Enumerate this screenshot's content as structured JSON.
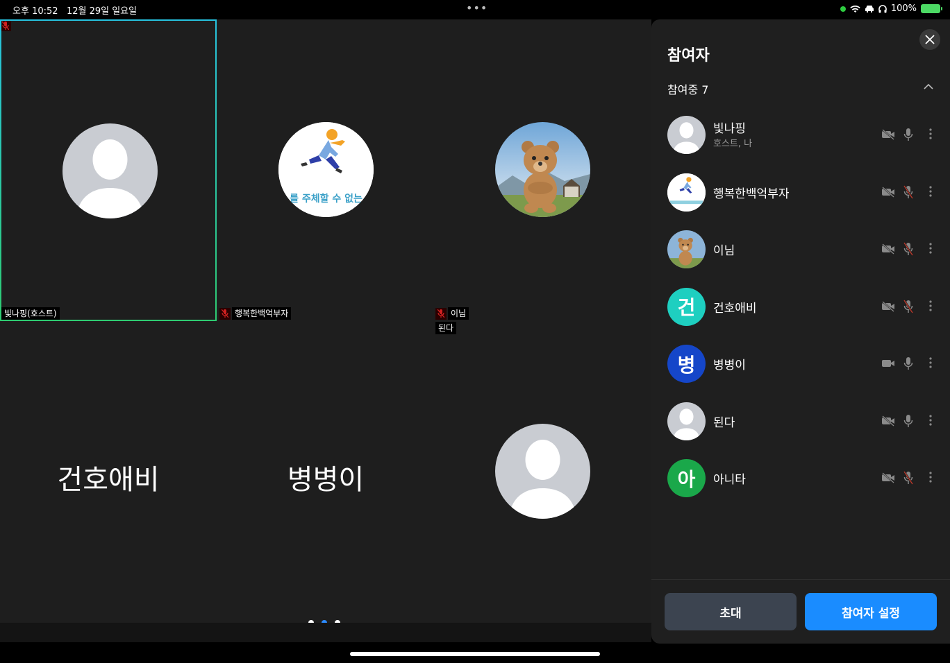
{
  "status_bar": {
    "time": "오후 10:52",
    "date": "12월 29일 일요일",
    "battery": "100%"
  },
  "grid": {
    "tiles": [
      {
        "label": "빛나핑(호스트)",
        "type": "avatar-default",
        "active": true,
        "muted": true
      },
      {
        "label": "행복한백억부자",
        "type": "avatar-runner",
        "muted": true
      },
      {
        "label": "이님",
        "type": "avatar-bear",
        "muted": true
      },
      {
        "big_name": "건호애비"
      },
      {
        "big_name": "병병이"
      },
      {
        "label": "된다",
        "type": "avatar-default"
      }
    ],
    "runner_caption": "를 주체할 수 없는",
    "pager": {
      "count": 3,
      "active": 1
    }
  },
  "panel": {
    "title": "참여자",
    "section_label": "참여중 7",
    "participants": [
      {
        "name": "빛나핑",
        "sub": "호스트, 나",
        "avatar": "default",
        "camera_off": true,
        "mic_muted": false
      },
      {
        "name": "행복한백억부자",
        "avatar": "runner",
        "camera_off": true,
        "mic_muted": true
      },
      {
        "name": "이님",
        "avatar": "bear",
        "camera_off": true,
        "mic_muted": true
      },
      {
        "name": "건호애비",
        "avatar": "letter",
        "initial": "건",
        "color": "#1ecfc0",
        "camera_off": true,
        "mic_muted": true
      },
      {
        "name": "병병이",
        "avatar": "letter",
        "initial": "병",
        "color": "#1546c9",
        "camera_off": false,
        "mic_muted": false
      },
      {
        "name": "된다",
        "avatar": "default",
        "camera_off": true,
        "mic_muted": false
      },
      {
        "name": "아니타",
        "avatar": "letter",
        "initial": "아",
        "color": "#1aa84a",
        "camera_off": true,
        "mic_muted": true
      }
    ],
    "invite_label": "초대",
    "settings_label": "참여자 설정"
  }
}
